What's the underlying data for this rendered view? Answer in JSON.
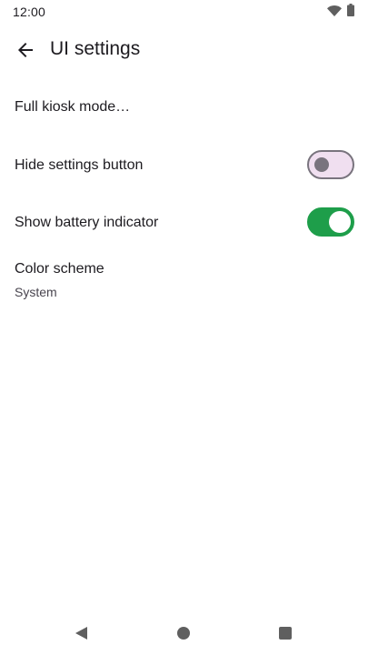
{
  "status_bar": {
    "time": "12:00",
    "icons": [
      "wifi-icon",
      "battery-icon"
    ]
  },
  "app_bar": {
    "back_icon": "arrow-left-icon",
    "title": "UI settings"
  },
  "settings": {
    "kiosk": {
      "label": "Full kiosk mode…"
    },
    "hide_settings": {
      "label": "Hide settings button",
      "checked": false
    },
    "battery": {
      "label": "Show battery indicator",
      "checked": true
    },
    "color_scheme": {
      "label": "Color scheme",
      "summary": "System"
    }
  },
  "nav_bar": {
    "icons": [
      "nav-back-icon",
      "nav-home-icon",
      "nav-recents-icon"
    ]
  },
  "colors": {
    "switch_on": "#1e9e4a",
    "switch_off_track": "#f0dff0",
    "switch_off_outline": "#79747e"
  }
}
